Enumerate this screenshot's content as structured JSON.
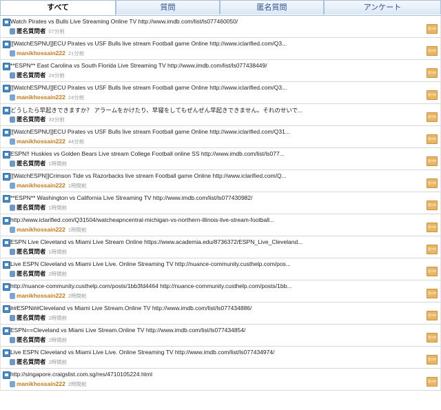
{
  "tabs": [
    {
      "label": "すべて",
      "active": true
    },
    {
      "label": "質問",
      "active": false
    },
    {
      "label": "匿名質問",
      "active": false
    },
    {
      "label": "アンケート",
      "active": false
    }
  ],
  "items": [
    {
      "title": "Watch Pirates vs Bulls Live Streaming Online TV http://www.imdb.com/list/ls077460050/",
      "author": "匿名質問者",
      "author_type": "anon",
      "time": "07分前",
      "badge": "受付中"
    },
    {
      "title": "[[WatchESPNU]]ECU Pirates vs USF Bulls live stream Football game Online http://www.iclarified.com/Q3...",
      "author": "manikhossain222",
      "author_type": "user",
      "time": "21分前",
      "badge": "受付中"
    },
    {
      "title": "**ESPN** East Carolina vs South Florida Live Streaming TV http://www.imdb.com/list/ls077438449/",
      "author": "匿名質問者",
      "author_type": "anon",
      "time": "24分前",
      "badge": "受付中"
    },
    {
      "title": "[[WatchESPNU]]ECU Pirates vs USF Bulls live stream Football game Online http://www.iclarified.com/Q3...",
      "author": "manikhossain222",
      "author_type": "user",
      "time": "24分前",
      "badge": "受付中"
    },
    {
      "title": "どうしたら早起きできますか？ アラームをかけたり、早寝をしてもぜんぜん早起きできません。それのせいで...",
      "author": "匿名質問者",
      "author_type": "anon",
      "time": "33分前",
      "badge": "受付中"
    },
    {
      "title": "[[WatchESPNU]]ECU Pirates vs USF Bulls live stream Football game Online http://www.iclarified.com/Q31...",
      "author": "manikhossain222",
      "author_type": "user",
      "time": "44分前",
      "badge": "受付中"
    },
    {
      "title": "ESPN!! Huskies vs Golden Bears Live stream College Football online SS http://www.imdb.com/list/ls077...",
      "author": "匿名質問者",
      "author_type": "anon",
      "time": "1時間前",
      "badge": "受付中"
    },
    {
      "title": "[[WatchESPN]]Crimson Tide vs Razorbacks live stream Football game Online http://www.iclarified.com/Q...",
      "author": "manikhossain222",
      "author_type": "user",
      "time": "1時間前",
      "badge": "受付中"
    },
    {
      "title": "**ESPN** Washington vs California Live Streaming TV http://www.imdb.com/list/ls077430982/",
      "author": "匿名質問者",
      "author_type": "anon",
      "time": "1時間前",
      "badge": "受付中"
    },
    {
      "title": "http://www.iclarified.com/Q31504/watcheapncentral-michigan-vs-northern-illinois-live-stream-football...",
      "author": "manikhossain222",
      "author_type": "user",
      "time": "1時間前",
      "badge": "受付中"
    },
    {
      "title": "ESPN Live Cleveland vs Miami Live Stream Online https://www.academia.edu/8736372/ESPN_Live_Cleveland...",
      "author": "匿名質問者",
      "author_type": "anon",
      "time": "1時間前",
      "badge": "受付中"
    },
    {
      "title": "Live ESPN Cleveland vs Miami Live Live. Online Streaming TV http://nuance-community.custhelp.com/pos...",
      "author": "匿名質問者",
      "author_type": "anon",
      "time": "2時間前",
      "badge": "受付中"
    },
    {
      "title": "http://nuance-community.custhelp.com/posts/1bb3fd4464 http://nuance-community.custhelp.com/posts/1bb...",
      "author": "manikhossain222",
      "author_type": "user",
      "time": "2時間前",
      "badge": "受付中"
    },
    {
      "title": "##ESPN##Cleveland vs Miami Live Stream.Online TV http://www.imdb.com/list/ls077434886/",
      "author": "匿名質問者",
      "author_type": "anon",
      "time": "2時間前",
      "badge": "受付中"
    },
    {
      "title": "ESPN==Cleveland vs Miami Live Stream.Online TV http://www.imdb.com/list/ls077434854/",
      "author": "匿名質問者",
      "author_type": "anon",
      "time": "2時間前",
      "badge": "受付中"
    },
    {
      "title": "Live ESPN Cleveland vs Miami Live Live. Online Streaming TV http://www.imdb.com/list/ls077434974/",
      "author": "匿名質問者",
      "author_type": "anon",
      "time": "2時間前",
      "badge": "受付中"
    },
    {
      "title": "http://singapore.craigslist.com.sg/res/4710105224.html",
      "author": "manikhossain222",
      "author_type": "user",
      "time": "2時間前",
      "badge": "受付中"
    }
  ],
  "colors": {
    "accent": "#2b4d8a",
    "user_name": "#c07a1a",
    "badge": "#e8b565"
  }
}
